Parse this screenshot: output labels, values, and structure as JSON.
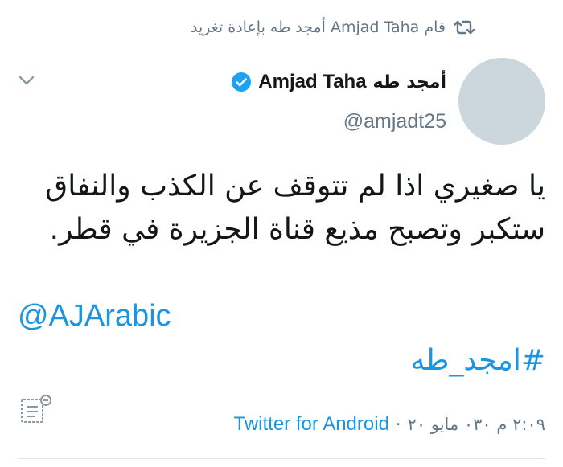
{
  "retweet": {
    "label": "قام Amjad Taha أمجد طه بإعادة تغريد",
    "icon": "retweet-icon"
  },
  "author": {
    "name_ar": "أمجد طه",
    "name_en": "Amjad Taha",
    "handle": "@amjadt25",
    "verified": true
  },
  "tweet": {
    "text": "يا صغيري اذا لم تتوقف عن الكذب والنفاق ستكبر وتصبح مذيع قناة الجزيرة في قطر.",
    "mention": "@AJArabic",
    "hashtag": "#امجد_طه"
  },
  "meta": {
    "timestamp": "٢:٠٩ م ٠٣٠ مايو ٢٠",
    "separator": "·",
    "source": "Twitter for Android"
  },
  "colors": {
    "link": "#1b95e0",
    "muted": "#657786",
    "verified": "#1da1f2",
    "avatar_placeholder": "#ccd6dd"
  }
}
